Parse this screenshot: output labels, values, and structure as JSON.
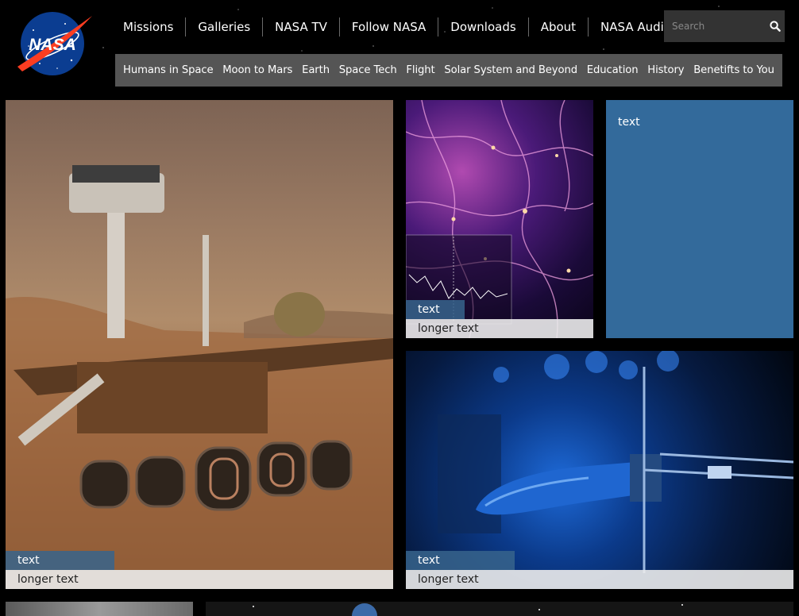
{
  "logo": {
    "text": "NASA"
  },
  "top_nav": [
    "Missions",
    "Galleries",
    "NASA TV",
    "Follow NASA",
    "Downloads",
    "About",
    "NASA Audiences"
  ],
  "search": {
    "placeholder": "Search"
  },
  "sub_nav": [
    "Humans in Space",
    "Moon to Mars",
    "Earth",
    "Space Tech",
    "Flight",
    "Solar System and Beyond",
    "Education",
    "History",
    "Benetifts to You"
  ],
  "tiles": {
    "rover": {
      "short": "text",
      "long": "longer text"
    },
    "cosmic": {
      "short": "text",
      "long": "longer text"
    },
    "blue": {
      "short": "text"
    },
    "engine": {
      "short": "text",
      "long": "longer text"
    }
  },
  "colors": {
    "nav_bg": "#555555",
    "tile_blue": "#336a9b",
    "nasa_red": "#fc3d21",
    "nasa_blue": "#0b3d91"
  }
}
